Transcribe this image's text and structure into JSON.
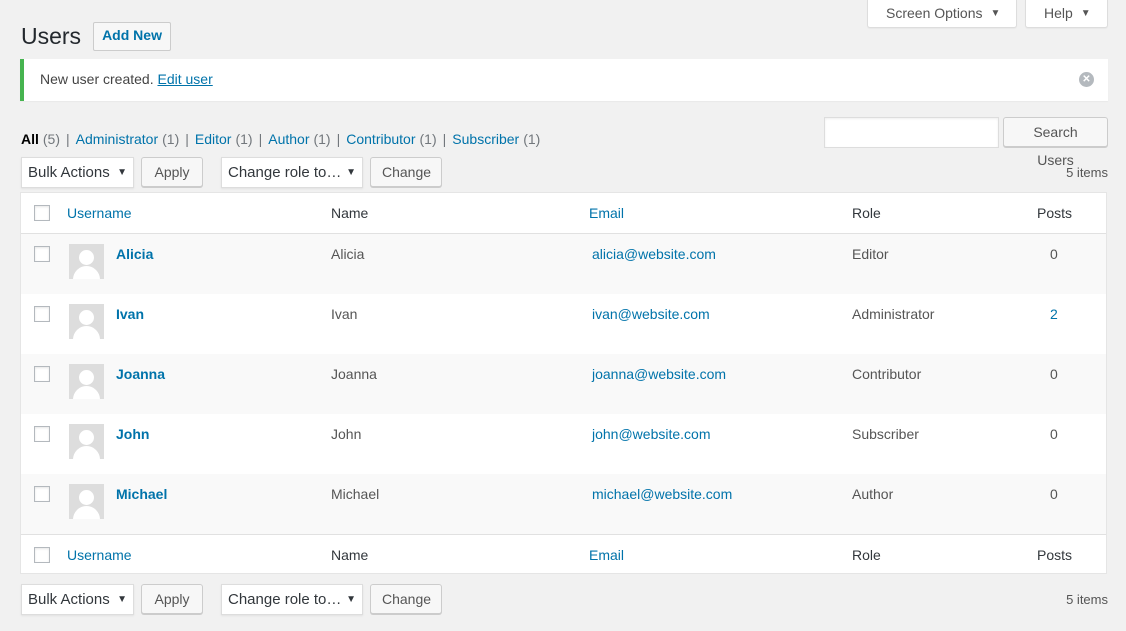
{
  "screen_options": {
    "label": "Screen Options"
  },
  "help": {
    "label": "Help"
  },
  "heading": {
    "title": "Users",
    "add_new": "Add New"
  },
  "notice": {
    "text": "New user created.",
    "link": "Edit user"
  },
  "views": [
    {
      "label": "All",
      "count": "(5)"
    },
    {
      "label": "Administrator",
      "count": "(1)"
    },
    {
      "label": "Editor",
      "count": "(1)"
    },
    {
      "label": "Author",
      "count": "(1)"
    },
    {
      "label": "Contributor",
      "count": "(1)"
    },
    {
      "label": "Subscriber",
      "count": "(1)"
    }
  ],
  "search": {
    "placeholder": "",
    "button": "Search Users"
  },
  "tablenav": {
    "bulk_actions": "Bulk Actions",
    "apply": "Apply",
    "change_role": "Change role to…",
    "change": "Change",
    "items": "5 items"
  },
  "columns": {
    "username": "Username",
    "name": "Name",
    "email": "Email",
    "role": "Role",
    "posts": "Posts"
  },
  "users": [
    {
      "username": "Alicia",
      "name": "Alicia",
      "email": "alicia@website.com",
      "role": "Editor",
      "posts": "0"
    },
    {
      "username": "Ivan",
      "name": "Ivan",
      "email": "ivan@website.com",
      "role": "Administrator",
      "posts": "2"
    },
    {
      "username": "Joanna",
      "name": "Joanna",
      "email": "joanna@website.com",
      "role": "Contributor",
      "posts": "0"
    },
    {
      "username": "John",
      "name": "John",
      "email": "john@website.com",
      "role": "Subscriber",
      "posts": "0"
    },
    {
      "username": "Michael",
      "name": "Michael",
      "email": "michael@website.com",
      "role": "Author",
      "posts": "0"
    }
  ],
  "icons": {
    "caret": "caret-down-icon",
    "dismiss": "dismiss-icon",
    "avatar": "default-avatar-icon"
  },
  "colors": {
    "link": "#0073aa",
    "notice_success": "#46b450",
    "background": "#f1f1f1"
  }
}
